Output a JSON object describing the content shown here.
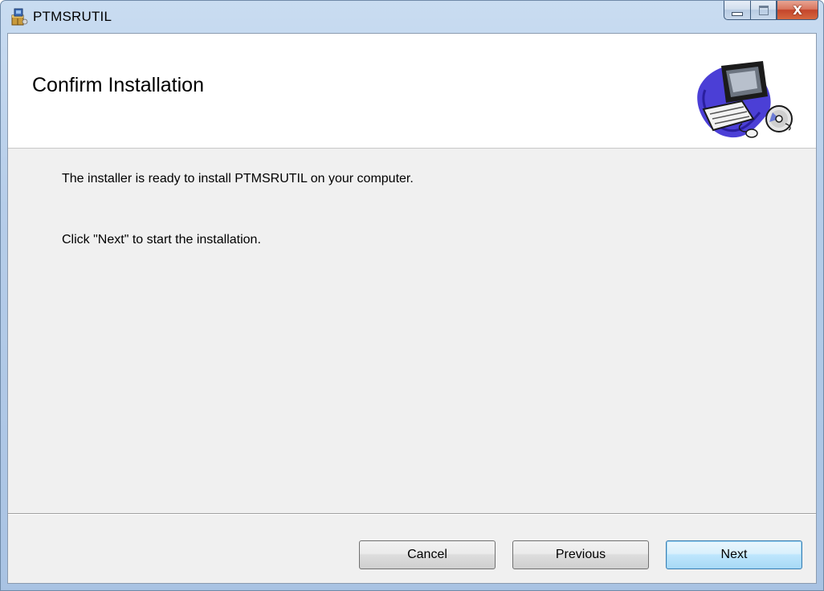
{
  "window": {
    "title": "PTMSRUTIL",
    "close_glyph": "X",
    "icons": {
      "app": "installer-package-icon",
      "minimize": "minimize-icon",
      "maximize": "maximize-icon",
      "close": "close-icon"
    }
  },
  "banner": {
    "title": "Confirm Installation",
    "art": "computer-with-cd-icon"
  },
  "body": {
    "line1": "The installer is ready to install PTMSRUTIL on your computer.",
    "line2": "Click \"Next\" to start the installation."
  },
  "buttons": {
    "cancel": "Cancel",
    "previous": "Previous",
    "next": "Next"
  },
  "colors": {
    "titlebar": "#b6cde9",
    "client_bg": "#f0f0f0",
    "close_button": "#c4452b",
    "default_button_border": "#3c7fb1"
  }
}
